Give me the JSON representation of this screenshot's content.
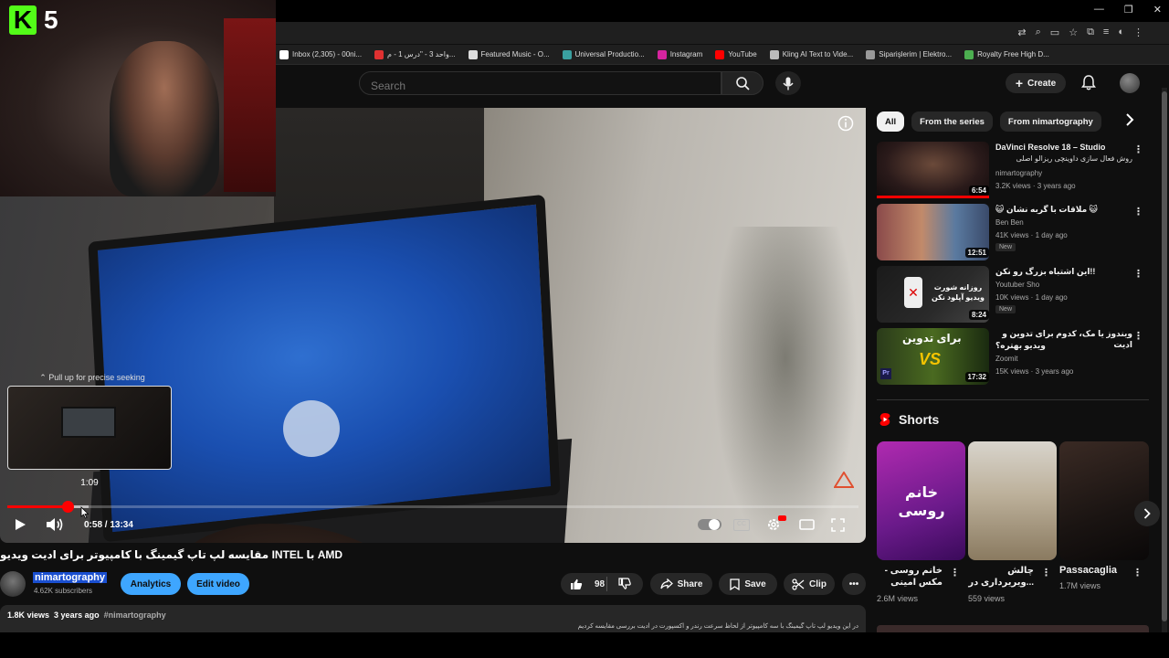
{
  "stream_overlay": {
    "badge_letter": "K",
    "badge_number": "5"
  },
  "window_controls": [
    "—",
    "❐",
    "✕"
  ],
  "bookmarks": [
    {
      "label": "Inbox (2,305) - 00ni...",
      "color": "#ffffff"
    },
    {
      "label": "واحد 3 - \"درس 1 - م...",
      "color": "#e03131"
    },
    {
      "label": "Featured Music - O...",
      "color": "#dddddd"
    },
    {
      "label": "Universal Productio...",
      "color": "#3aa0a0"
    },
    {
      "label": "Instagram",
      "color": "#d6249f"
    },
    {
      "label": "YouTube",
      "color": "#ff0000"
    },
    {
      "label": "Kling AI Text to Vide...",
      "color": "#bbbbbb"
    },
    {
      "label": "Siparişlerim | Elektro...",
      "color": "#999999"
    },
    {
      "label": "Royalty Free High D...",
      "color": "#4caf50"
    }
  ],
  "header": {
    "search_placeholder": "Search",
    "create_label": "Create"
  },
  "player": {
    "seek_hint": "Pull up for precise seeking",
    "preview_time": "1:09",
    "time": "0:58 / 13:34",
    "progress": 0.071,
    "buffered": 0.095
  },
  "video": {
    "title": "مقایسه لپ تاپ گیمینگ با کامپیوتر برای ادیت ویدیو INTEL با AMD",
    "channel": "nimartography",
    "subscribers": "4.62K subscribers",
    "analytics_label": "Analytics",
    "edit_label": "Edit video",
    "likes": "98",
    "share_label": "Share",
    "save_label": "Save",
    "clip_label": "Clip",
    "views": "1.8K views",
    "age": "3 years ago",
    "hashtag": "#nimartography",
    "description": "در این ویدیو لپ تاپ گیمینگ با سه کامپیوتر از لحاظ سرعت رندر و اکسپورت در ادیت بررسی مقایسه کردیم"
  },
  "chips": [
    "All",
    "From the series",
    "From nimartography"
  ],
  "recommendations": [
    {
      "title": "DaVinci Resolve 18 – Studio",
      "subtitle": "روش فعال سازی داوینچی ریزالو اصلی",
      "channel": "nimartography",
      "meta": "3.2K views · 3 years ago",
      "duration": "6:54",
      "watched": 1.0,
      "is_new": false
    },
    {
      "title": "😺 ملاقات با گربه نشان 😺",
      "subtitle": "",
      "channel": "Ben Ben",
      "meta": "41K views · 1 day ago",
      "duration": "12:51",
      "watched": 0,
      "is_new": true
    },
    {
      "title": "این اشتباه بزرگ رو نکن!!",
      "subtitle": "",
      "channel": "Youtuber Sho",
      "meta": "10K views · 1 day ago",
      "duration": "8:24",
      "watched": 0,
      "is_new": true
    },
    {
      "title": "ویندوز یا مک، کدوم برای تدوین و ادیت",
      "subtitle": "ویدیو بهتره؟",
      "channel": "Zoomit",
      "meta": "15K views · 3 years ago",
      "duration": "17:32",
      "watched": 0,
      "is_new": false
    }
  ],
  "new_badge": "New",
  "shorts": {
    "heading": "Shorts",
    "items": [
      {
        "title": "خانم روسی -",
        "title2": "مکس امینی",
        "views": "2.6M views"
      },
      {
        "title": "چالش",
        "title2": "...ویریرداری در",
        "views": "559 views"
      },
      {
        "title": "Passacaglia",
        "title2": "",
        "views": "1.7M views"
      }
    ]
  },
  "thumbnail_texts": {
    "rec3_overlay": "روزانه شورت ویدیو آپلود نکن",
    "rec4_overlay": "برای تدوین",
    "short1_overlay": "خانم روسی",
    "rec4_vs": "VS",
    "rec4_pr": "Pr"
  }
}
